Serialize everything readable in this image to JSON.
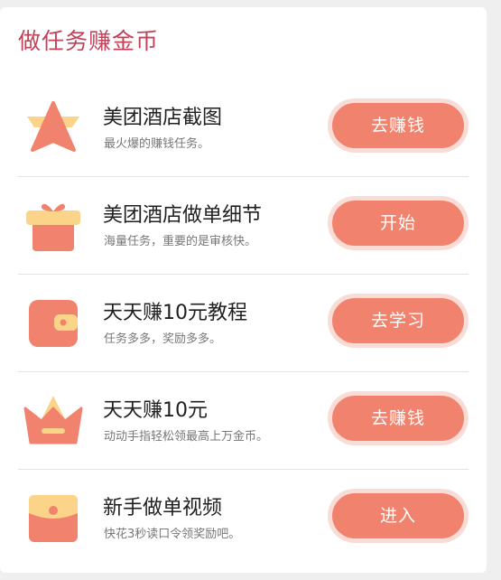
{
  "header": {
    "title": "做任务赚金币"
  },
  "colors": {
    "accent": "#f0826e",
    "accent_light": "#fbd48a",
    "title": "#c3425a"
  },
  "tasks": [
    {
      "icon": "star-icon",
      "name": "美团酒店截图",
      "desc": "最火爆的赚钱任务。",
      "button": "去赚钱"
    },
    {
      "icon": "gift-icon",
      "name": "美团酒店做单细节",
      "desc": "海量任务，重要的是审核快。",
      "button": "开始"
    },
    {
      "icon": "wallet-icon",
      "name": "天天赚10元教程",
      "desc": "任务多多，奖励多多。",
      "button": "去学习"
    },
    {
      "icon": "crown-icon",
      "name": "天天赚10元",
      "desc": "动动手指轻松领最高上万金币。",
      "button": "去赚钱"
    },
    {
      "icon": "red-envelope-icon",
      "name": "新手做单视频",
      "desc": "快花3秒读口令领奖励吧。",
      "button": "进入"
    }
  ]
}
